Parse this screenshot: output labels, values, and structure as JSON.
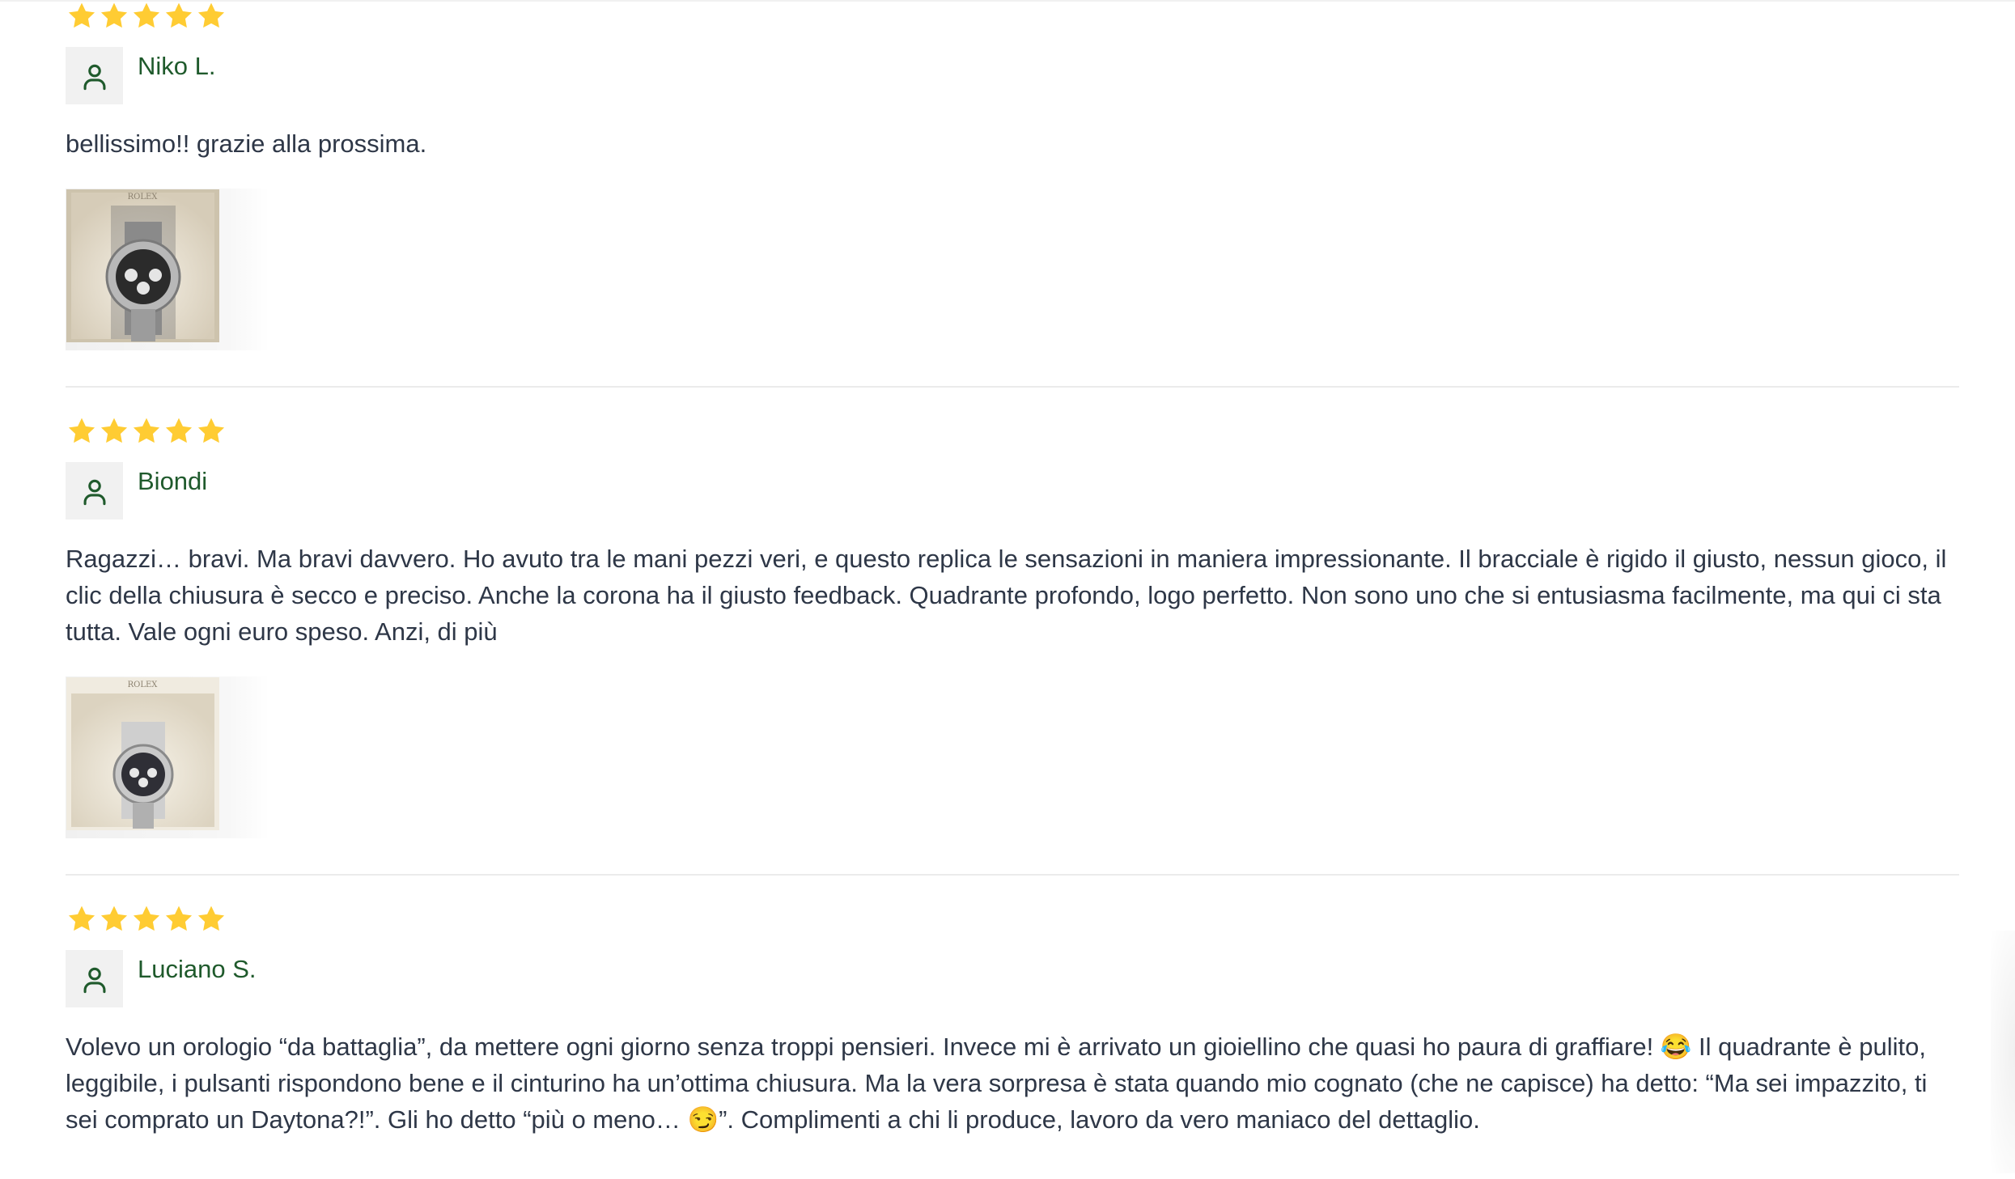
{
  "colors": {
    "star": "#FFCC33",
    "author": "#1f5a2c",
    "text": "#2e3747",
    "avatar_bg": "#f1f1f1",
    "divider": "#ebebeb"
  },
  "reviews": [
    {
      "rating": 5,
      "author": "Niko L.",
      "text": "bellissimo!! grazie alla prossima.",
      "photo": {
        "brand_text": "ROLEX",
        "icon": "watch-in-box-photo"
      }
    },
    {
      "rating": 5,
      "author": "Biondi",
      "text": "Ragazzi… bravi. Ma bravi davvero. Ho avuto tra le mani pezzi veri, e questo replica le sensazioni in maniera impressionante. Il bracciale è rigido il giusto, nessun gioco, il clic della chiusura è secco e preciso. Anche la corona ha il giusto feedback. Quadrante profondo, logo perfetto. Non sono uno che si entusiasma facilmente, ma qui ci sta tutta. Vale ogni euro speso. Anzi, di più",
      "photo": {
        "brand_text": "ROLEX",
        "icon": "watch-in-box-photo"
      }
    },
    {
      "rating": 5,
      "author": "Luciano S.",
      "text": "Volevo un orologio “da battaglia”, da mettere ogni giorno senza troppi pensieri. Invece mi è arrivato un gioiellino che quasi ho paura di graffiare! 😂 Il quadrante è pulito, leggibile, i pulsanti rispondono bene e il cinturino ha un’ottima chiusura. Ma la vera sorpresa è stata quando mio cognato (che ne capisce) ha detto: “Ma sei impazzito, ti sei comprato un Daytona?!”. Gli ho detto “più o meno… 😏”. Complimenti a chi li produce, lavoro da vero maniaco del dettaglio."
    }
  ]
}
